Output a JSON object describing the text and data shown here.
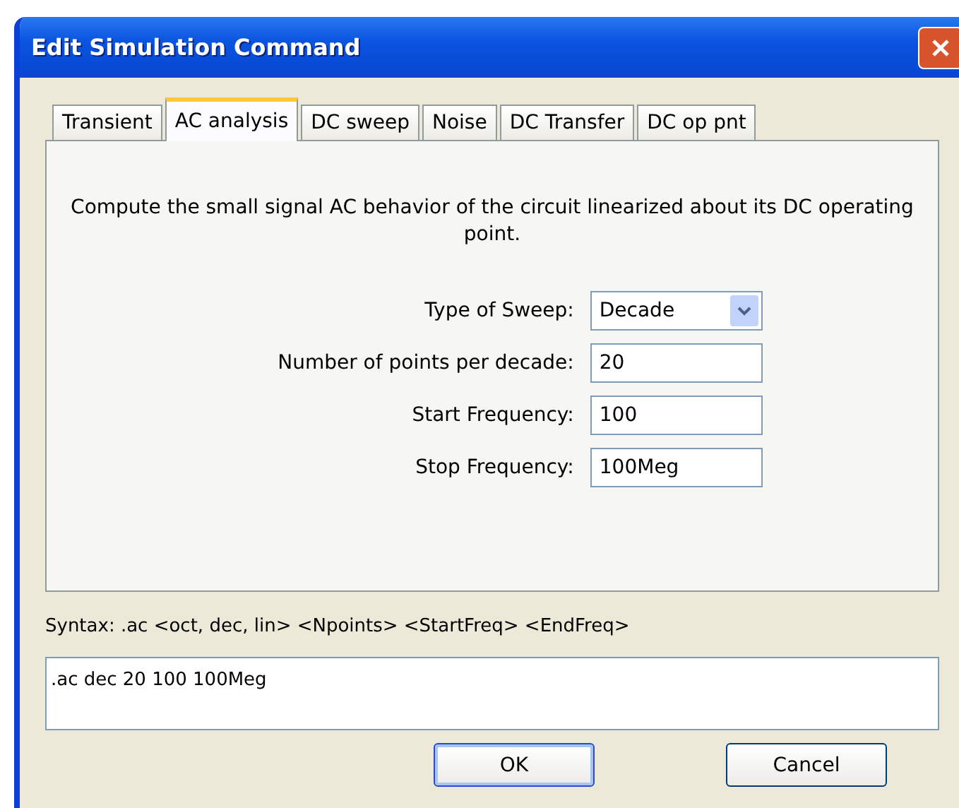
{
  "window": {
    "title": "Edit Simulation Command"
  },
  "tabs": [
    {
      "label": "Transient",
      "selected": false
    },
    {
      "label": "AC analysis",
      "selected": true
    },
    {
      "label": "DC sweep",
      "selected": false
    },
    {
      "label": "Noise",
      "selected": false
    },
    {
      "label": "DC Transfer",
      "selected": false
    },
    {
      "label": "DC op pnt",
      "selected": false
    }
  ],
  "description": "Compute the small signal AC behavior of the circuit linearized about its DC operating point.",
  "fields": [
    {
      "kind": "dropdown",
      "label": "Type of Sweep:",
      "value": "Decade"
    },
    {
      "kind": "text",
      "label": "Number of points per decade:",
      "value": "20"
    },
    {
      "kind": "text",
      "label": "Start Frequency:",
      "value": "100"
    },
    {
      "kind": "text",
      "label": "Stop Frequency:",
      "value": "100Meg"
    }
  ],
  "syntax": "Syntax:  .ac <oct, dec, lin> <Npoints> <StartFreq> <EndFreq>",
  "command": ".ac dec 20 100 100Meg",
  "buttons": [
    {
      "label": "OK",
      "default": true
    },
    {
      "label": "Cancel",
      "default": false
    }
  ]
}
